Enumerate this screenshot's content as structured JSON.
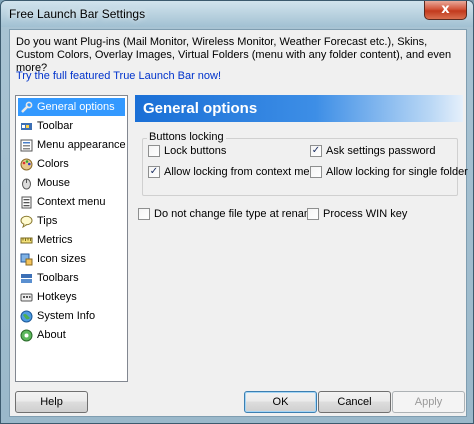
{
  "window": {
    "title": "Free Launch Bar Settings",
    "close_glyph": "x"
  },
  "intro": {
    "text": "Do you want Plug-ins (Mail Monitor, Wireless Monitor, Weather Forecast etc.), Skins, Custom Colors, Overlay Images, Virtual Folders (menu with any folder content), and even more?",
    "link": "Try the full featured True Launch Bar now!"
  },
  "nav": {
    "items": [
      {
        "label": "General options",
        "icon": "wrench-icon",
        "selected": true
      },
      {
        "label": "Toolbar",
        "icon": "toolbar-icon"
      },
      {
        "label": "Menu appearance",
        "icon": "menu-icon"
      },
      {
        "label": "Colors",
        "icon": "palette-icon"
      },
      {
        "label": "Mouse",
        "icon": "mouse-icon"
      },
      {
        "label": "Context menu",
        "icon": "context-menu-icon"
      },
      {
        "label": "Tips",
        "icon": "tip-balloon-icon"
      },
      {
        "label": "Metrics",
        "icon": "metrics-icon"
      },
      {
        "label": "Icon sizes",
        "icon": "icon-sizes-icon"
      },
      {
        "label": "Toolbars",
        "icon": "toolbars-icon"
      },
      {
        "label": "Hotkeys",
        "icon": "hotkeys-icon"
      },
      {
        "label": "System Info",
        "icon": "globe-icon"
      },
      {
        "label": "About",
        "icon": "about-icon"
      }
    ]
  },
  "content": {
    "header": "General options",
    "group_label": "Buttons locking",
    "checkboxes": {
      "lock_buttons": {
        "label": "Lock buttons",
        "checked": false
      },
      "ask_password": {
        "label": "Ask settings password",
        "checked": true
      },
      "allow_context": {
        "label": "Allow locking from context menu",
        "checked": true
      },
      "allow_single": {
        "label": "Allow locking for single folder",
        "checked": false
      },
      "no_change_type": {
        "label": "Do not change file type at rename",
        "checked": false
      },
      "process_win": {
        "label": "Process WIN key",
        "checked": false
      }
    },
    "check_glyph": "✓"
  },
  "buttons": {
    "help": "Help",
    "ok": "OK",
    "cancel": "Cancel",
    "apply": "Apply"
  },
  "colors": {
    "accent": "#3399ff",
    "header_start": "#1a6fd6",
    "link": "#0033cc"
  }
}
